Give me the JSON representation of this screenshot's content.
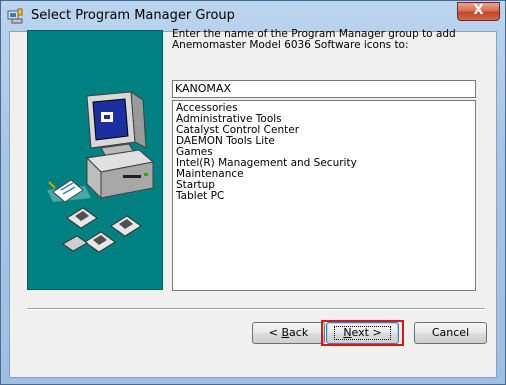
{
  "window": {
    "title": "Select Program Manager Group",
    "close_glyph": "X"
  },
  "dialog": {
    "prompt_line1": "Enter the name of the Program Manager group to add",
    "prompt_line2": "Anemomaster Model 6036 Software icons to:",
    "group_name_value": "KANOMAX",
    "group_list": [
      "Accessories",
      "Administrative Tools",
      "Catalyst Control Center",
      "DAEMON Tools Lite",
      "Games",
      "Intel(R) Management and Security",
      "Maintenance",
      "Startup",
      "Tablet PC"
    ]
  },
  "buttons": {
    "back_prefix": "< ",
    "back_mnemonic": "B",
    "back_rest": "ack",
    "next_mnemonic": "N",
    "next_rest": "ext >",
    "cancel": "Cancel"
  },
  "icons": {
    "title_icon": "setup-icon",
    "art": "computer-with-disks-illustration"
  },
  "colors": {
    "art_panel_bg": "#008080",
    "highlight_box": "#e01414"
  }
}
